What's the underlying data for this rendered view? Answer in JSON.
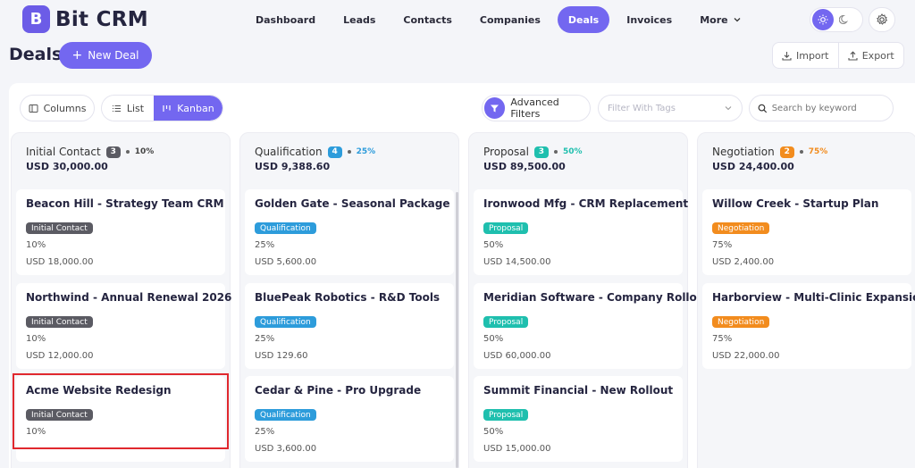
{
  "app": {
    "logo_letter": "B",
    "name": "Bit CRM"
  },
  "nav": [
    {
      "label": "Dashboard",
      "active": false
    },
    {
      "label": "Leads",
      "active": false
    },
    {
      "label": "Contacts",
      "active": false
    },
    {
      "label": "Companies",
      "active": false
    },
    {
      "label": "Deals",
      "active": true
    },
    {
      "label": "Invoices",
      "active": false
    },
    {
      "label": "More",
      "active": false
    }
  ],
  "page": {
    "title": "Deals",
    "new_button": "New Deal",
    "import": "Import",
    "export": "Export"
  },
  "toolbar": {
    "columns": "Columns",
    "list": "List",
    "kanban": "Kanban",
    "advanced_filters": "Advanced Filters",
    "tags_placeholder": "Filter With Tags",
    "search_placeholder": "Search by keyword"
  },
  "colors": {
    "accent": "#7367f0",
    "initial": "#5b5b63",
    "qualification": "#2d9cdb",
    "proposal": "#1fbfae",
    "negotiation": "#f28c1e",
    "highlight": "#e0282e"
  },
  "columns": [
    {
      "name": "Initial Contact",
      "count": "3",
      "pct": "10%",
      "total": "USD 30,000.00",
      "color": "#5b5b63",
      "pct_color": "#444444",
      "cards": [
        {
          "title": "Beacon Hill - Strategy Team CRM",
          "badge": "Initial Contact",
          "pct": "10%",
          "amount": "USD 18,000.00"
        },
        {
          "title": "Northwind - Annual Renewal 2026",
          "badge": "Initial Contact",
          "pct": "10%",
          "amount": "USD 12,000.00"
        },
        {
          "title": "Acme Website Redesign",
          "badge": "Initial Contact",
          "pct": "10%",
          "amount": ""
        }
      ]
    },
    {
      "name": "Qualification",
      "count": "4",
      "pct": "25%",
      "total": "USD 9,388.60",
      "color": "#2d9cdb",
      "pct_color": "#2d9cdb",
      "cards": [
        {
          "title": "Golden Gate - Seasonal Package",
          "badge": "Qualification",
          "pct": "25%",
          "amount": "USD 5,600.00"
        },
        {
          "title": "BluePeak Robotics - R&D Tools",
          "badge": "Qualification",
          "pct": "25%",
          "amount": "USD 129.60"
        },
        {
          "title": "Cedar & Pine - Pro Upgrade",
          "badge": "Qualification",
          "pct": "25%",
          "amount": "USD 3,600.00"
        }
      ]
    },
    {
      "name": "Proposal",
      "count": "3",
      "pct": "50%",
      "total": "USD 89,500.00",
      "color": "#1fbfae",
      "pct_color": "#1fbfae",
      "cards": [
        {
          "title": "Ironwood Mfg - CRM Replacement",
          "badge": "Proposal",
          "pct": "50%",
          "amount": "USD 14,500.00"
        },
        {
          "title": "Meridian Software - Company Rollout",
          "badge": "Proposal",
          "pct": "50%",
          "amount": "USD 60,000.00"
        },
        {
          "title": "Summit Financial - New Rollout",
          "badge": "Proposal",
          "pct": "50%",
          "amount": "USD 15,000.00"
        }
      ]
    },
    {
      "name": "Negotiation",
      "count": "2",
      "pct": "75%",
      "total": "USD 24,400.00",
      "color": "#f28c1e",
      "pct_color": "#f28c1e",
      "cards": [
        {
          "title": "Willow Creek - Startup Plan",
          "badge": "Negotiation",
          "pct": "75%",
          "amount": "USD 2,400.00"
        },
        {
          "title": "Harborview - Multi-Clinic Expansion",
          "badge": "Negotiation",
          "pct": "75%",
          "amount": "USD 22,000.00"
        }
      ]
    }
  ]
}
